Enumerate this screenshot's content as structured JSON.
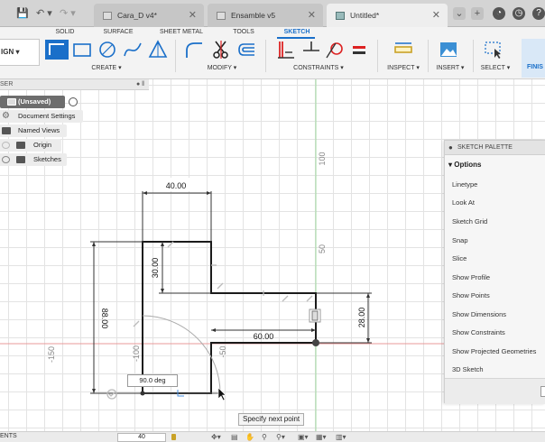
{
  "title_bar": {
    "save_icon": "save-icon",
    "undo_icon": "undo-icon",
    "redo_icon": "redo-icon",
    "tabs": [
      {
        "label": "Cara_D v4*",
        "close": "✕"
      },
      {
        "label": "Ensamble v5",
        "close": "✕"
      },
      {
        "label": "Untitled*",
        "close": "✕"
      }
    ],
    "new_tab": "+"
  },
  "workspace_tabs": [
    "SOLID",
    "SURFACE",
    "SHEET METAL",
    "TOOLS",
    "SKETCH"
  ],
  "design_button": "IGN",
  "tool_groups": [
    "CREATE",
    "MODIFY",
    "CONSTRAINTS",
    "INSPECT",
    "INSERT",
    "SELECT"
  ],
  "finish_label": "FINIS",
  "browser": {
    "header": "SER",
    "items": [
      {
        "label": "(Unsaved)"
      },
      {
        "label": "Document Settings"
      },
      {
        "label": "Named Views"
      },
      {
        "label": "Origin"
      },
      {
        "label": "Sketches"
      }
    ]
  },
  "palette": {
    "title": "SKETCH PALETTE",
    "section": "Options",
    "items": [
      "Linetype",
      "Look At",
      "Sketch Grid",
      "Snap",
      "Slice",
      "Show Profile",
      "Show Points",
      "Show Dimensions",
      "Show Constraints",
      "Show Projected Geometries",
      "3D Sketch"
    ]
  },
  "sketch": {
    "dims": {
      "top": "40.00",
      "left_inner": "30.00",
      "left_outer": "88.00",
      "bottom_right": "60.00",
      "right": "28.00"
    },
    "axis_labels": {
      "v100": "100",
      "v50": "50",
      "h_150": "-150",
      "h_100": "-100",
      "h_50": "-50"
    },
    "angle_input": "90.0 deg",
    "tooltip": "Specify next point"
  },
  "bottom_bar": {
    "label": "ENTS",
    "input_value": "40"
  }
}
